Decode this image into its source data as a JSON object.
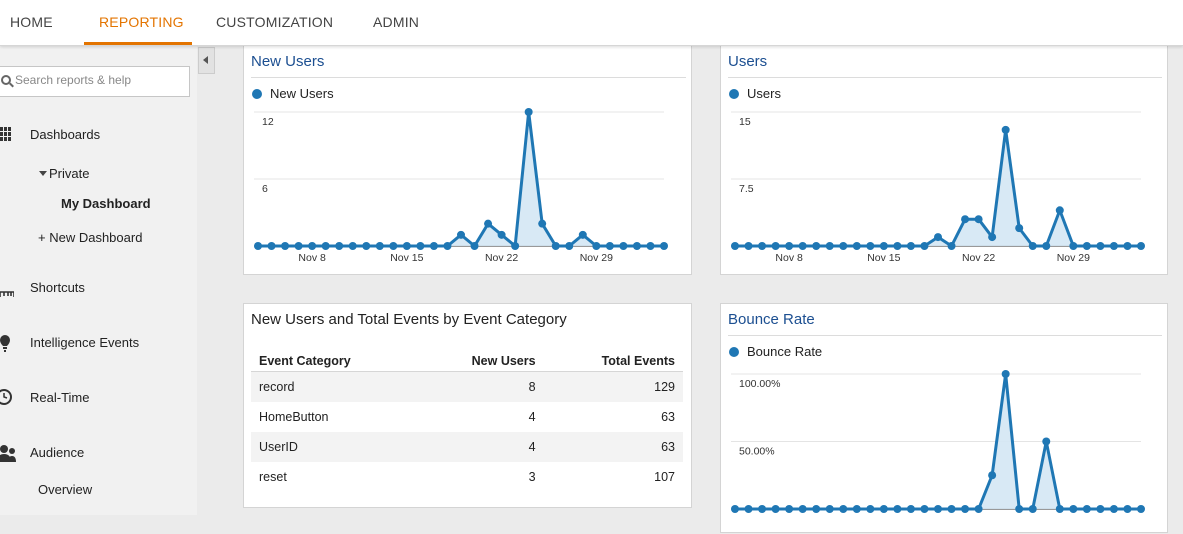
{
  "topnav": {
    "tabs": [
      {
        "label": "HOME",
        "active": false
      },
      {
        "label": "REPORTING",
        "active": true
      },
      {
        "label": "CUSTOMIZATION",
        "active": false
      },
      {
        "label": "ADMIN",
        "active": false
      }
    ]
  },
  "sidebar": {
    "search_placeholder": "Search reports & help",
    "dashboards": "Dashboards",
    "private": "Private",
    "my_dashboard": "My Dashboard",
    "new_dashboard": "+ New Dashboard",
    "shortcuts": "Shortcuts",
    "intelligence": "Intelligence Events",
    "realtime": "Real-Time",
    "audience": "Audience",
    "overview": "Overview"
  },
  "colors": {
    "accent": "#e37400",
    "link": "#1c4f91",
    "series": "#1f77b4"
  },
  "panels": {
    "new_users": {
      "title": "New Users",
      "legend": "New Users"
    },
    "users": {
      "title": "Users",
      "legend": "Users"
    },
    "table": {
      "title": "New Users and Total Events by Event Category",
      "headers": [
        "Event Category",
        "New Users",
        "Total Events"
      ],
      "rows": [
        [
          "record",
          "8",
          "129"
        ],
        [
          "HomeButton",
          "4",
          "63"
        ],
        [
          "UserID",
          "4",
          "63"
        ],
        [
          "reset",
          "3",
          "107"
        ]
      ]
    },
    "bounce": {
      "title": "Bounce Rate",
      "legend": "Bounce Rate"
    }
  },
  "chart_data": [
    {
      "type": "area",
      "title": "New Users",
      "series": [
        {
          "name": "New Users",
          "values": [
            0,
            0,
            0,
            0,
            0,
            0,
            0,
            0,
            0,
            0,
            0,
            0,
            0,
            0,
            0,
            1,
            0,
            2,
            1,
            0,
            12,
            2,
            0,
            0,
            1,
            0,
            0,
            0,
            0,
            0,
            0
          ]
        }
      ],
      "x_ticks": [
        {
          "index": 4,
          "label": "Nov 8"
        },
        {
          "index": 11,
          "label": "Nov 15"
        },
        {
          "index": 18,
          "label": "Nov 22"
        },
        {
          "index": 25,
          "label": "Nov 29"
        }
      ],
      "y_ticks": [
        "12",
        "6"
      ],
      "ylim": [
        0,
        12
      ]
    },
    {
      "type": "area",
      "title": "Users",
      "series": [
        {
          "name": "Users",
          "values": [
            0,
            0,
            0,
            0,
            0,
            0,
            0,
            0,
            0,
            0,
            0,
            0,
            0,
            0,
            0,
            1,
            0,
            3,
            3,
            1,
            13,
            2,
            0,
            0,
            4,
            0,
            0,
            0,
            0,
            0,
            0
          ]
        }
      ],
      "x_ticks": [
        {
          "index": 4,
          "label": "Nov 8"
        },
        {
          "index": 11,
          "label": "Nov 15"
        },
        {
          "index": 18,
          "label": "Nov 22"
        },
        {
          "index": 25,
          "label": "Nov 29"
        }
      ],
      "y_ticks": [
        "15",
        "7.5"
      ],
      "ylim": [
        0,
        15
      ]
    },
    {
      "type": "area",
      "title": "Bounce Rate",
      "series": [
        {
          "name": "Bounce Rate",
          "values": [
            0,
            0,
            0,
            0,
            0,
            0,
            0,
            0,
            0,
            0,
            0,
            0,
            0,
            0,
            0,
            0,
            0,
            0,
            0,
            25,
            100,
            0,
            0,
            50,
            0,
            0,
            0,
            0,
            0,
            0,
            0
          ]
        }
      ],
      "y_ticks": [
        "100.00%",
        "50.00%"
      ],
      "ylim": [
        0,
        100
      ]
    }
  ]
}
